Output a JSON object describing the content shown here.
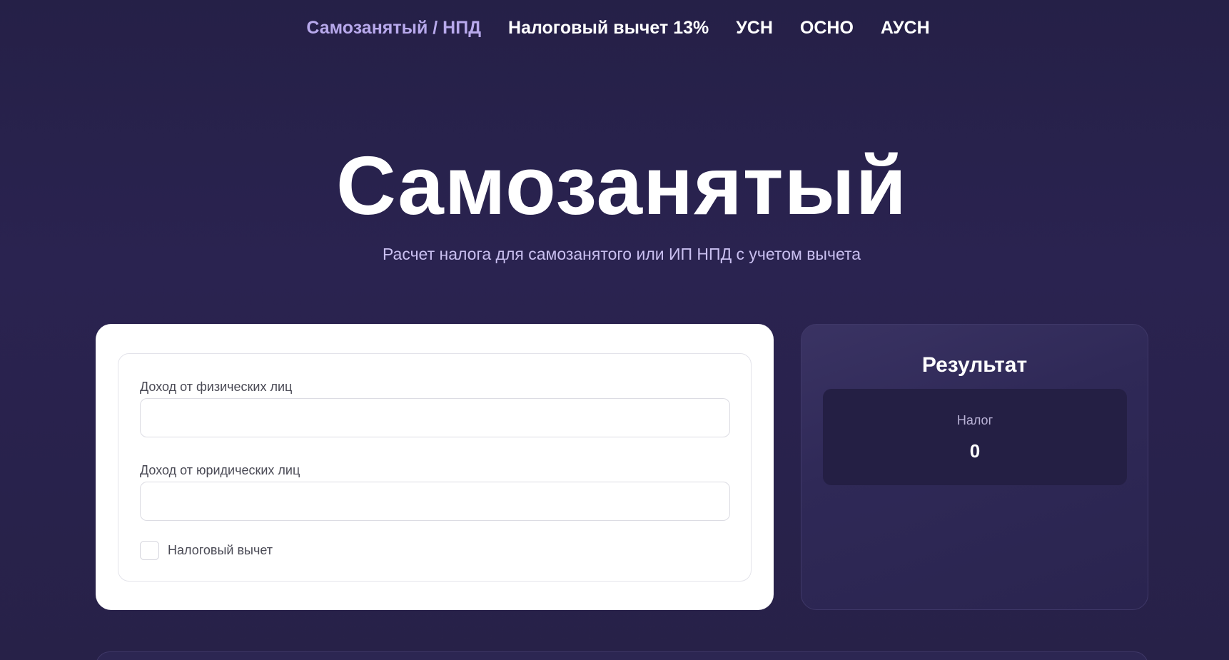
{
  "nav": {
    "items": [
      {
        "label": "Самозанятый / НПД",
        "active": true
      },
      {
        "label": "Налоговый вычет 13%",
        "active": false
      },
      {
        "label": "УСН",
        "active": false
      },
      {
        "label": "ОСНО",
        "active": false
      },
      {
        "label": "АУСН",
        "active": false
      }
    ]
  },
  "hero": {
    "title": "Самозанятый",
    "subtitle": "Расчет налога для самозанятого или ИП НПД с учетом вычета"
  },
  "form": {
    "individuals_label": "Доход от физических лиц",
    "individuals_value": "",
    "legal_label": "Доход от юридических лиц",
    "legal_value": "",
    "deduction_label": "Налоговый вычет",
    "deduction_checked": false
  },
  "result": {
    "title": "Результат",
    "tax_label": "Налог",
    "tax_value": "0"
  },
  "colors": {
    "background": "#252047",
    "active_nav": "#b8a9ec",
    "subtitle": "#c9bff0",
    "card": "#ffffff",
    "result_card": "#2f2957"
  }
}
